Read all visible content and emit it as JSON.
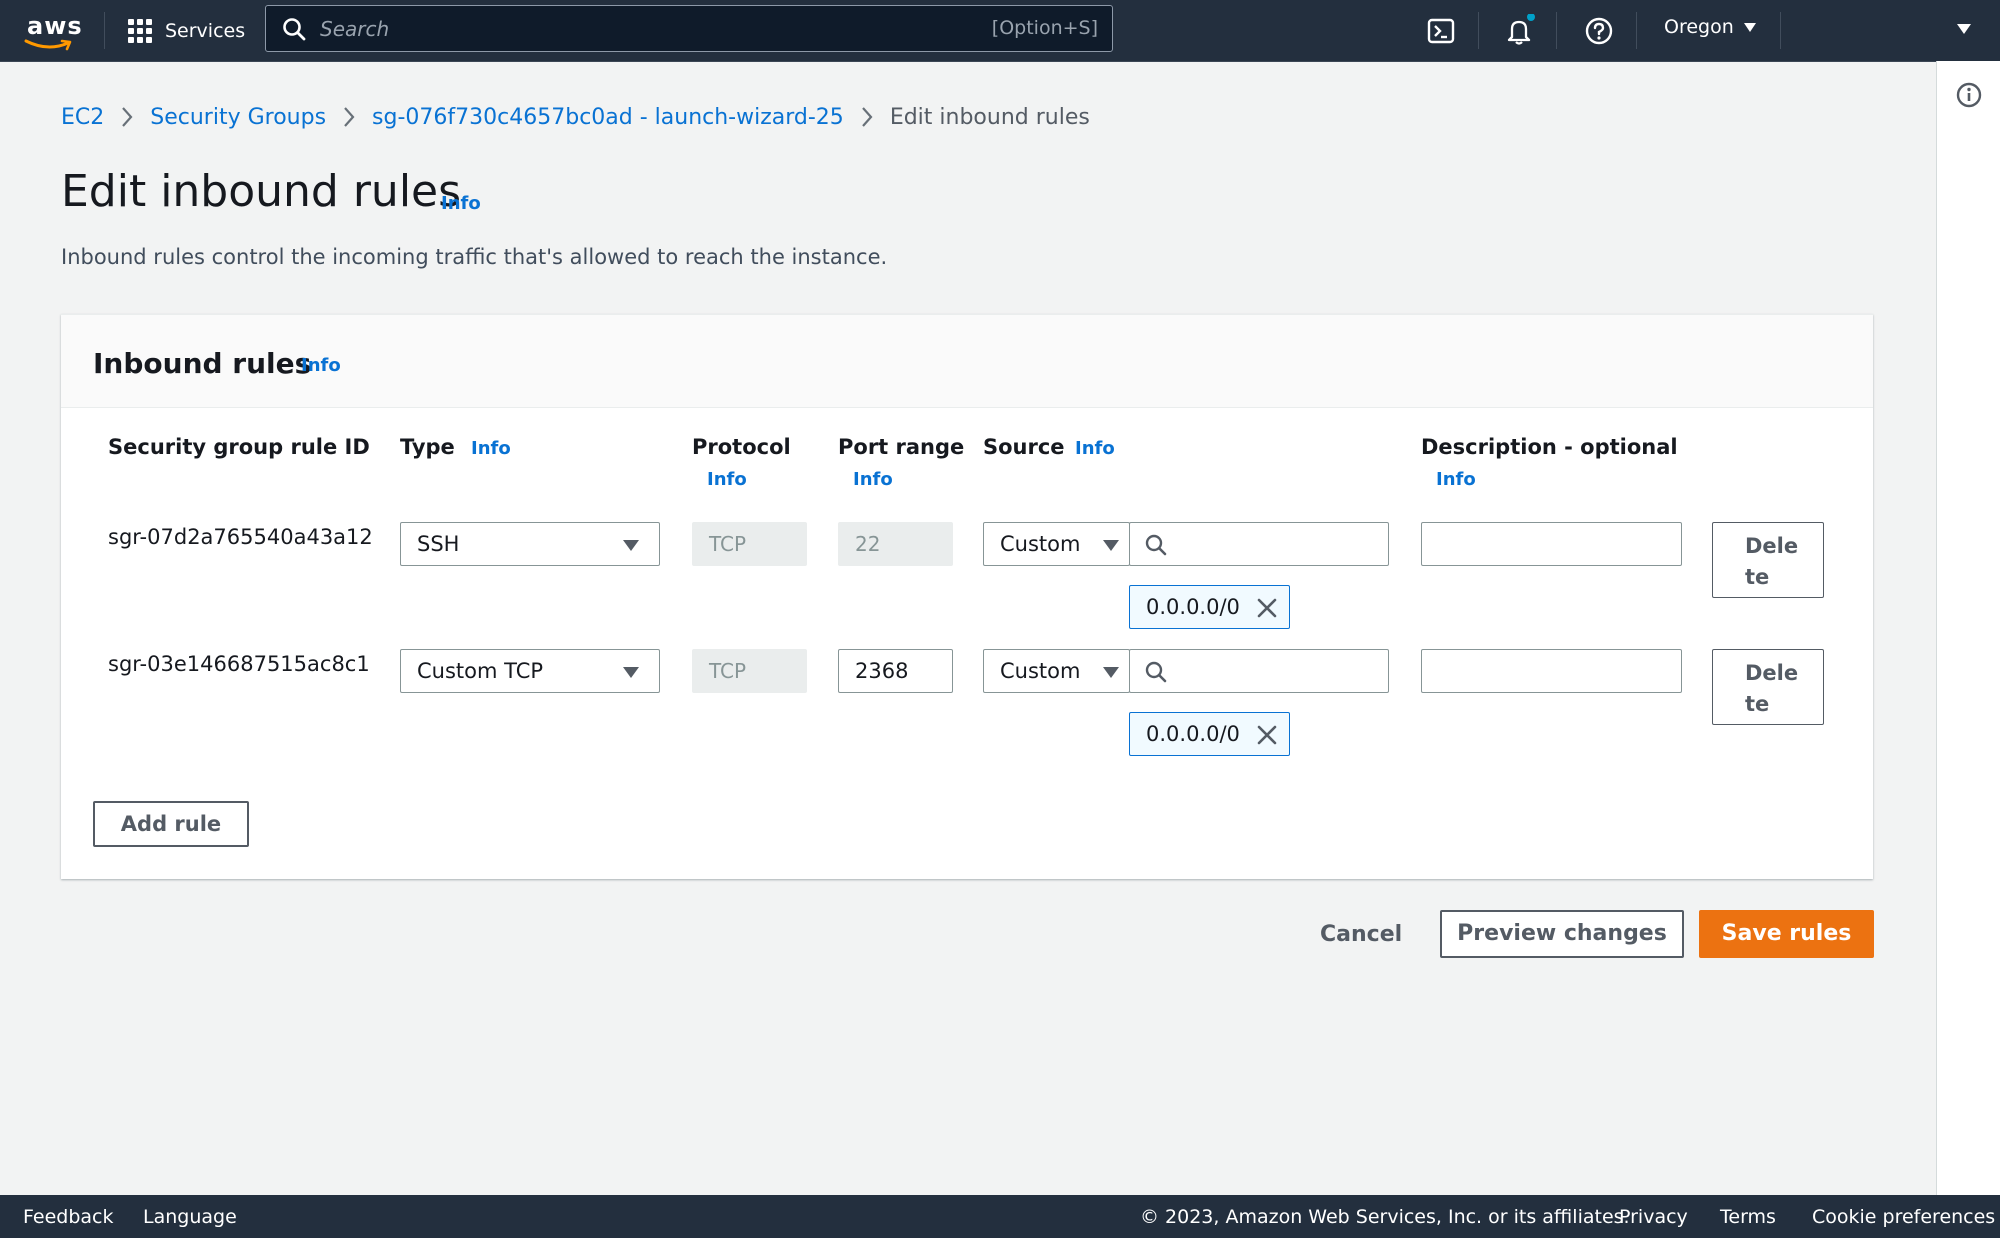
{
  "topnav": {
    "logo_text": "aws",
    "services_label": "Services",
    "search_placeholder": "Search",
    "search_shortcut": "[Option+S]",
    "region": "Oregon"
  },
  "breadcrumb": {
    "items": [
      "EC2",
      "Security Groups",
      "sg-076f730c4657bc0ad - launch-wizard-25"
    ],
    "current": "Edit inbound rules"
  },
  "page": {
    "title": "Edit inbound rules",
    "title_info": "Info",
    "description": "Inbound rules control the incoming traffic that's allowed to reach the instance."
  },
  "panel": {
    "title": "Inbound rules",
    "info": "Info",
    "columns": {
      "rule_id": "Security group rule ID",
      "type": "Type",
      "protocol": "Protocol",
      "port_range": "Port range",
      "source": "Source",
      "description": "Description - optional",
      "info": "Info"
    },
    "rules": [
      {
        "id": "sgr-07d2a765540a43a12",
        "type": "SSH",
        "protocol": "TCP",
        "port": "22",
        "source_type": "Custom",
        "source_search": "",
        "source_cidr": "0.0.0.0/0",
        "description": "",
        "delete_label_1": "Dele",
        "delete_label_2": "te"
      },
      {
        "id": "sgr-03e146687515ac8c1",
        "type": "Custom TCP",
        "protocol": "TCP",
        "port": "2368",
        "source_type": "Custom",
        "source_search": "",
        "source_cidr": "0.0.0.0/0",
        "description": "",
        "delete_label_1": "Dele",
        "delete_label_2": "te"
      }
    ],
    "add_rule_label": "Add rule"
  },
  "actions": {
    "cancel": "Cancel",
    "preview": "Preview changes",
    "save": "Save rules"
  },
  "footer": {
    "feedback": "Feedback",
    "language": "Language",
    "copyright": "© 2023, Amazon Web Services, Inc. or its affiliates.",
    "privacy": "Privacy",
    "terms": "Terms",
    "cookies": "Cookie preferences"
  },
  "colors": {
    "nav_bg": "#232f3e",
    "link": "#0972d3",
    "primary_button": "#ec7211",
    "notification_dot": "#00a1c9"
  }
}
